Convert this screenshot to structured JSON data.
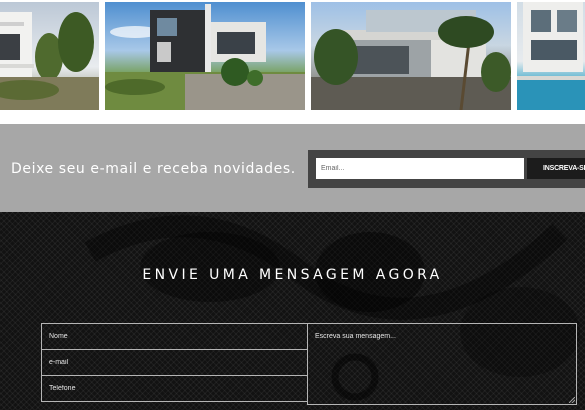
{
  "gallery": {
    "items": [
      {
        "icon": "house-render-image"
      },
      {
        "icon": "house-render-image"
      },
      {
        "icon": "house-render-image"
      },
      {
        "icon": "house-render-image"
      }
    ]
  },
  "newsletter": {
    "text": "Deixe seu e-mail e receba novidades.",
    "email_placeholder": "Email...",
    "button_label": "INSCREVA-SE"
  },
  "contact": {
    "title": "ENVIE UMA MENSAGEM AGORA",
    "name_placeholder": "Nome",
    "email_placeholder": "e-mail",
    "phone_placeholder": "Telefone",
    "message_placeholder": "Escreva sua mensagem..."
  },
  "colors": {
    "newsletter_band": "#a7a7a7",
    "newsletter_form": "#444444",
    "button": "#1c1c1c",
    "contact_bg": "#121212",
    "field_border": "#b5b5b5"
  }
}
